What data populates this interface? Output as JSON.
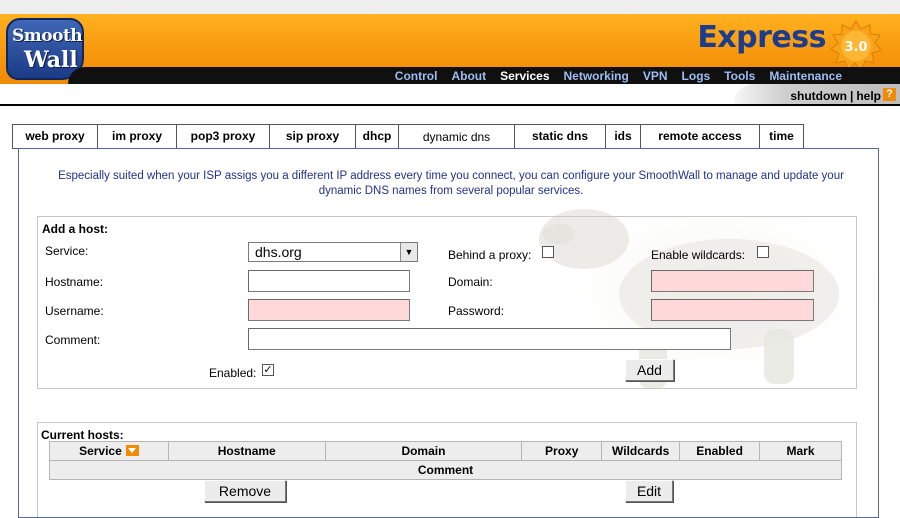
{
  "brand": {
    "logo_line1": "Smooth",
    "logo_line2": "Wall",
    "product": "Express",
    "version": "3.0",
    "accent": "#f18a06",
    "nav_color": "#9dbcf1"
  },
  "nav": [
    "Control",
    "About",
    "Services",
    "Networking",
    "VPN",
    "Logs",
    "Tools",
    "Maintenance"
  ],
  "nav_active": "Services",
  "subbar": {
    "shutdown": "shutdown",
    "separator": "|",
    "help": "help",
    "help_icon": "?"
  },
  "tabs": [
    {
      "label": "web proxy"
    },
    {
      "label": "im proxy"
    },
    {
      "label": "pop3 proxy"
    },
    {
      "label": "sip proxy"
    },
    {
      "label": "dhcp"
    },
    {
      "label": "dynamic dns"
    },
    {
      "label": "static dns"
    },
    {
      "label": "ids"
    },
    {
      "label": "remote access"
    },
    {
      "label": "time"
    }
  ],
  "active_tab": "dynamic dns",
  "intro": "Especially suited when your ISP assigs you a different IP address every time you connect, you can configure your SmoothWall to manage and update your dynamic DNS names from several popular services.",
  "add_host": {
    "legend": "Add a host:",
    "service_label": "Service:",
    "service_value": "dhs.org",
    "behind_proxy_label": "Behind a proxy:",
    "behind_proxy_checked": false,
    "wildcards_label": "Enable wildcards:",
    "wildcards_checked": false,
    "hostname_label": "Hostname:",
    "hostname_value": "",
    "domain_label": "Domain:",
    "domain_value": "",
    "username_label": "Username:",
    "username_value": "",
    "password_label": "Password:",
    "password_value": "",
    "comment_label": "Comment:",
    "comment_value": "",
    "enabled_label": "Enabled:",
    "enabled_checked": true,
    "add_button": "Add",
    "required_color": "#ffd9d9"
  },
  "current_hosts": {
    "legend": "Current hosts:",
    "columns": [
      "Service",
      "Hostname",
      "Domain",
      "Proxy",
      "Wildcards",
      "Enabled",
      "Mark"
    ],
    "comment_header": "Comment",
    "remove_button": "Remove",
    "edit_button": "Edit"
  }
}
